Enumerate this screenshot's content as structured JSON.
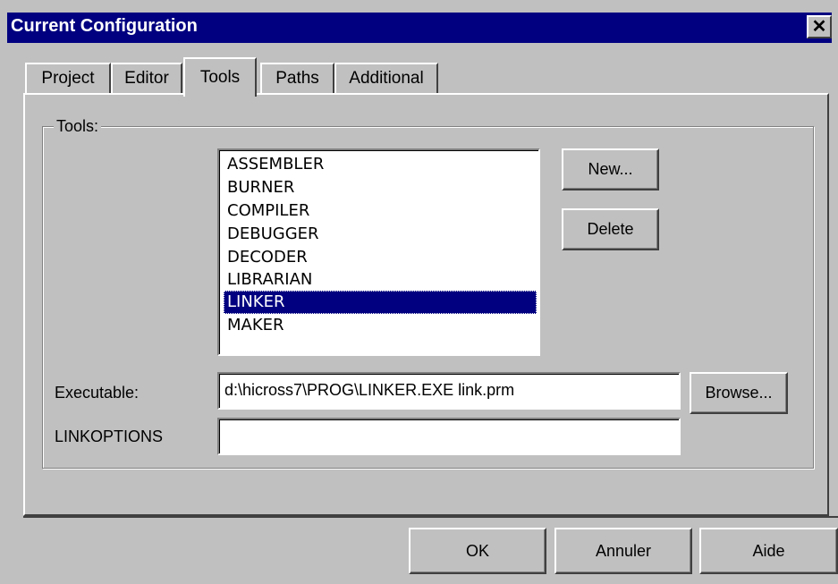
{
  "window": {
    "title": "Current Configuration",
    "close_glyph": "✕"
  },
  "tabs": [
    {
      "label": "Project",
      "active": false
    },
    {
      "label": "Editor",
      "active": false
    },
    {
      "label": "Tools",
      "active": true
    },
    {
      "label": "Paths",
      "active": false
    },
    {
      "label": "Additional",
      "active": false
    }
  ],
  "tools_group": {
    "label": "Tools:",
    "list_items": [
      "ASSEMBLER",
      "BURNER",
      "COMPILER",
      "DEBUGGER",
      "DECODER",
      "LIBRARIAN",
      "LINKER",
      "MAKER"
    ],
    "selected_item": "LINKER",
    "new_button": "New...",
    "delete_button": "Delete",
    "executable_label": "Executable:",
    "executable_value": "d:\\hicross7\\PROG\\LINKER.EXE link.prm",
    "browse_button": "Browse...",
    "options_label": "LINKOPTIONS",
    "options_value": ""
  },
  "footer": {
    "ok_button": "OK",
    "cancel_button": "Annuler",
    "help_button": "Aide"
  },
  "colors": {
    "titlebar": "#000080",
    "face": "#c0c0c0",
    "selection": "#000080"
  }
}
